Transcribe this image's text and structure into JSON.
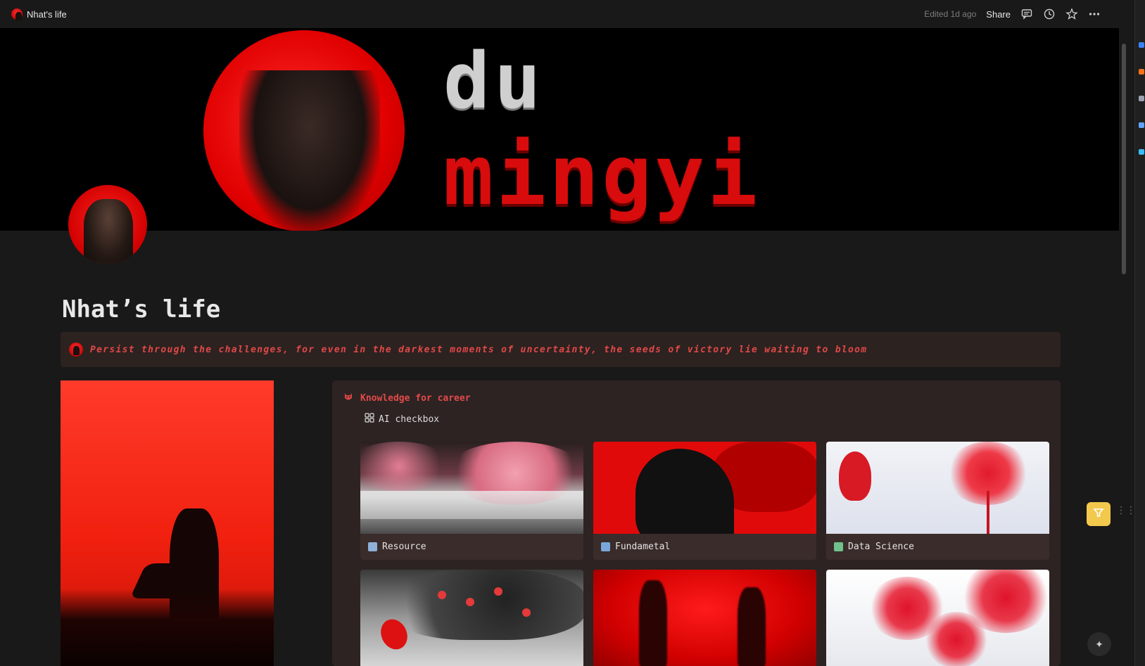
{
  "topbar": {
    "breadcrumb": "Nhat's life",
    "edited": "Edited 1d ago",
    "share": "Share",
    "icons": [
      "comment-icon",
      "history-icon",
      "star-icon",
      "more-icon"
    ]
  },
  "cover": {
    "line1": "du",
    "line2": "mingyi"
  },
  "page": {
    "title": "Nhat’s life",
    "quote": "Persist through the challenges, for even in the darkest moments of uncertainty, the seeds of victory lie waiting to bloom"
  },
  "database": {
    "title": "Knowledge for career",
    "view_label": "AI checkbox",
    "cards": [
      {
        "label": "Resource",
        "icon": "books-icon",
        "icon_color": "#8fb0d8"
      },
      {
        "label": "Fundametal",
        "icon": "chart-icon",
        "icon_color": "#7aa7d9"
      },
      {
        "label": "Data Science",
        "icon": "pencil-icon",
        "icon_color": "#6fc28b"
      },
      {
        "label": "",
        "icon": "",
        "icon_color": ""
      },
      {
        "label": "",
        "icon": "",
        "icon_color": ""
      },
      {
        "label": "",
        "icon": "",
        "icon_color": ""
      }
    ]
  },
  "colors": {
    "accent_red": "#e24a4a",
    "background": "#191919",
    "panel": "#2d2322",
    "callout": "#2c2220",
    "fab_yellow": "#f2c94c"
  }
}
